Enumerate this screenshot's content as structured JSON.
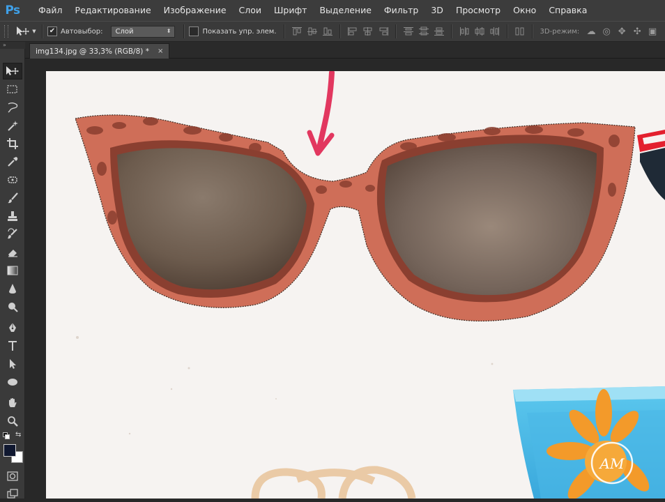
{
  "app": {
    "logo": "Ps"
  },
  "menu": [
    "Файл",
    "Редактирование",
    "Изображение",
    "Слои",
    "Шрифт",
    "Выделение",
    "Фильтр",
    "3D",
    "Просмотр",
    "Окно",
    "Справка"
  ],
  "options": {
    "tool_icon": "move-tool-icon",
    "autoselect_label": "Автовыбор:",
    "autoselect_checked": true,
    "autoselect_target": "Слой",
    "show_transform_label": "Показать упр. элем.",
    "show_transform_checked": false,
    "mode_3d_label": "3D-режим:"
  },
  "panel_collapse_glyph": "»",
  "document_tab": {
    "title": "img134.jpg @ 33,3% (RGB/8) *",
    "close_glyph": "×"
  },
  "tools": [
    "move-tool",
    "rectangular-marquee-tool",
    "lasso-tool",
    "magic-wand-tool",
    "crop-tool",
    "eyedropper-tool",
    "healing-brush-tool",
    "brush-tool",
    "clone-stamp-tool",
    "history-brush-tool",
    "eraser-tool",
    "gradient-tool",
    "blur-tool",
    "dodge-tool",
    "pen-tool",
    "type-tool",
    "path-selection-tool",
    "ellipse-tool",
    "hand-tool",
    "zoom-tool"
  ],
  "colors": {
    "foreground": "#101830",
    "background": "#ffffff",
    "app_bg": "#282828",
    "panel_bg": "#3a3a3a",
    "logo": "#3fa0e8"
  },
  "canvas": {
    "watermark": "AM"
  }
}
